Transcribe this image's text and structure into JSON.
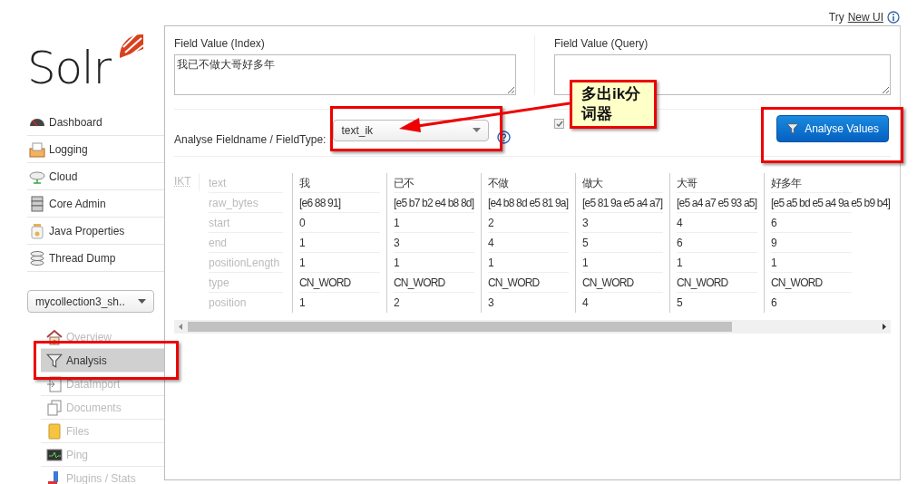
{
  "header": {
    "prefix": "Try",
    "link": "New UI"
  },
  "logo": {
    "text": "Solr"
  },
  "nav": [
    {
      "label": "Dashboard",
      "kind": "gauge"
    },
    {
      "label": "Logging",
      "kind": "inbox"
    },
    {
      "label": "Cloud",
      "kind": "cloud"
    },
    {
      "label": "Core Admin",
      "kind": "server"
    },
    {
      "label": "Java Properties",
      "kind": "jar"
    },
    {
      "label": "Thread Dump",
      "kind": "stack"
    }
  ],
  "core_selector": {
    "value": "mycollection3_sh.."
  },
  "core_nav": [
    {
      "label": "Overview",
      "kind": "house",
      "selected": false
    },
    {
      "label": "Analysis",
      "kind": "funnel",
      "selected": true
    },
    {
      "label": "DataImport",
      "kind": "import",
      "selected": false
    },
    {
      "label": "Documents",
      "kind": "docs",
      "selected": false
    },
    {
      "label": "Files",
      "kind": "folder",
      "selected": false
    },
    {
      "label": "Ping",
      "kind": "monitor",
      "selected": false
    },
    {
      "label": "Plugins / Stats",
      "kind": "plug",
      "selected": false
    }
  ],
  "analysis": {
    "index_label": "Field Value (Index)",
    "index_value": "我已不做大哥好多年",
    "query_label": "Field Value (Query)",
    "fieldtype_label": "Analyse Fieldname / FieldType:",
    "fieldtype_value": "text_ik",
    "verbose_checked": true,
    "button": "Analyse Values"
  },
  "result": {
    "tokenizer": "IKT",
    "attributes": [
      "text",
      "raw_bytes",
      "start",
      "end",
      "positionLength",
      "type",
      "position"
    ],
    "tokens": [
      [
        "我",
        "[e6 88 91]",
        "0",
        "1",
        "1",
        "CN_WORD",
        "1"
      ],
      [
        "已不",
        "[e5 b7 b2 e4 b8 8d]",
        "1",
        "3",
        "1",
        "CN_WORD",
        "2"
      ],
      [
        "不做",
        "[e4 b8 8d e5 81 9a]",
        "2",
        "4",
        "1",
        "CN_WORD",
        "3"
      ],
      [
        "做大",
        "[e5 81 9a e5 a4 a7]",
        "3",
        "5",
        "1",
        "CN_WORD",
        "4"
      ],
      [
        "大哥",
        "[e5 a4 a7 e5 93 a5]",
        "4",
        "6",
        "1",
        "CN_WORD",
        "5"
      ],
      [
        "好多年",
        "[e5 a5 bd e5 a4 9a e5 b9 b4]",
        "6",
        "9",
        "1",
        "CN_WORD",
        "6"
      ]
    ]
  },
  "annotation": {
    "text": "多出ik分词器"
  }
}
